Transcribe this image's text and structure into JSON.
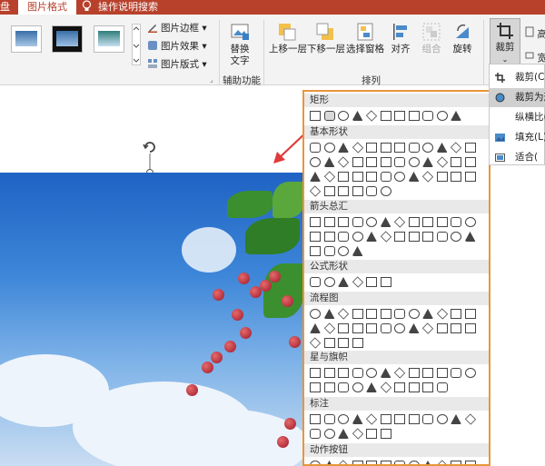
{
  "tabs": {
    "partial": "盘",
    "picture_format": "图片格式",
    "tell_me": "操作说明搜索"
  },
  "ribbon": {
    "border_label": "图片边框",
    "effects_label": "图片效果",
    "layout_label": "图片版式",
    "alt_text_line1": "替换",
    "alt_text_line2": "文字",
    "accessibility_group": "辅助功能",
    "bring_forward": "上移一层",
    "send_backward": "下移一层",
    "selection_pane": "选择窗格",
    "align": "对齐",
    "group": "组合",
    "rotate": "旋转",
    "arrange_group": "排列",
    "crop": "裁剪",
    "height_partial": "高",
    "width_partial": "宽"
  },
  "shapes_gallery": {
    "categories": [
      "矩形",
      "基本形状",
      "箭头总汇",
      "公式形状",
      "流程图",
      "星与旗帜",
      "标注",
      "动作按钮"
    ]
  },
  "crop_menu": {
    "items": [
      {
        "label": "裁剪(C)",
        "icon": "crop-icon"
      },
      {
        "label": "裁剪为形",
        "icon": "crop-to-shape-icon"
      },
      {
        "label": "纵横比(",
        "icon": ""
      },
      {
        "label": "填充(L)",
        "icon": "fill-icon"
      },
      {
        "label": "适合(",
        "icon": "fit-icon"
      }
    ]
  },
  "colors": {
    "tab_bar": "#b8412c",
    "gallery_border": "#e8963a",
    "arrow": "#e03a3a"
  }
}
